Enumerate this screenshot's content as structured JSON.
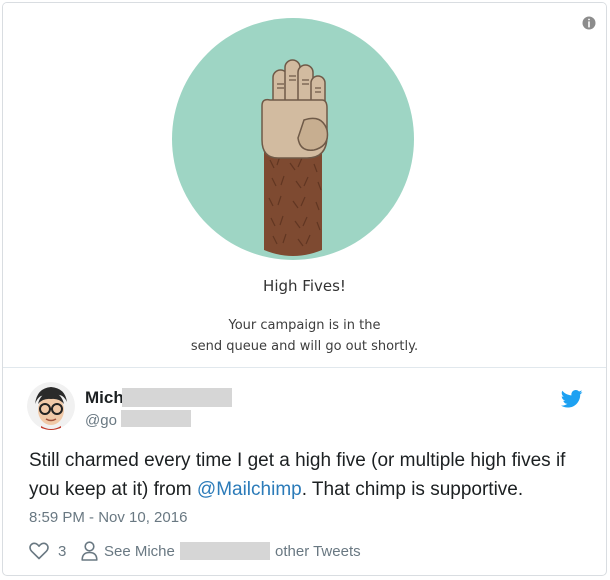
{
  "card": {
    "title": "High Fives!",
    "message_line1": "Your campaign is in the",
    "message_line2": "send queue and will go out shortly.",
    "info_icon": "info-icon",
    "illustration": "high-five-hand-icon",
    "circle_color": "#9ed5c4"
  },
  "tweet": {
    "name": "Mich",
    "handle": "@go",
    "text_before": "Still charmed every time I get a high five (or multiple high fives if you keep at it) from ",
    "mention": "@Mailchimp",
    "text_after": ". That chimp is supportive.",
    "timestamp": "8:59 PM - Nov 10, 2016",
    "like_count": "3",
    "see_prefix": "See Miche",
    "see_suffix": "other Tweets",
    "brand_color": "#1da1f2",
    "link_color": "#2b7bb9"
  }
}
